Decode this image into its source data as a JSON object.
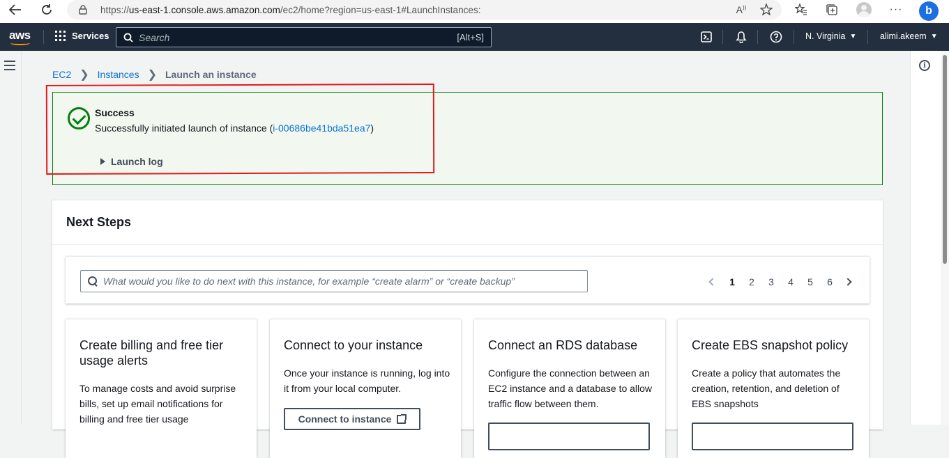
{
  "browser": {
    "url_prefix": "https://",
    "url_host": "us-east-1.console.aws.amazon.com",
    "url_path": "/ec2/home?region=us-east-1#LaunchInstances:"
  },
  "aws_header": {
    "logo_text": "aws",
    "services_label": "Services",
    "search_placeholder": "Search",
    "search_shortcut": "[Alt+S]",
    "region_label": "N. Virginia",
    "account_label": "alimi.akeem"
  },
  "breadcrumb": {
    "items": [
      "EC2",
      "Instances"
    ],
    "current": "Launch an instance"
  },
  "alert": {
    "title": "Success",
    "message_prefix": "Successfully initiated launch of instance (",
    "instance_id": "i-00686be41bda51ea7",
    "message_suffix": ")",
    "log_label": "Launch log"
  },
  "next_steps": {
    "heading": "Next Steps",
    "filter_placeholder": "What would you like to do next with this instance, for example “create alarm” or “create backup”",
    "pages": [
      "1",
      "2",
      "3",
      "4",
      "5",
      "6"
    ],
    "active_page": "1",
    "cards": [
      {
        "title": "Create billing and free tier usage alerts",
        "body": "To manage costs and avoid surprise bills, set up email notifications for billing and free tier usage"
      },
      {
        "title": "Connect to your instance",
        "body": "Once your instance is running, log into it from your local computer.",
        "button": "Connect to instance"
      },
      {
        "title": "Connect an RDS database",
        "body": "Configure the connection between an EC2 instance and a database to allow traffic flow between them."
      },
      {
        "title": "Create EBS snapshot policy",
        "body": "Create a policy that automates the creation, retention, and deletion of EBS snapshots"
      }
    ]
  },
  "colors": {
    "aws_navy": "#232f3e",
    "aws_orange": "#ff9900",
    "link_blue": "#0972d3",
    "success_green": "#037f0c",
    "annotation_red": "#e01b1b"
  }
}
